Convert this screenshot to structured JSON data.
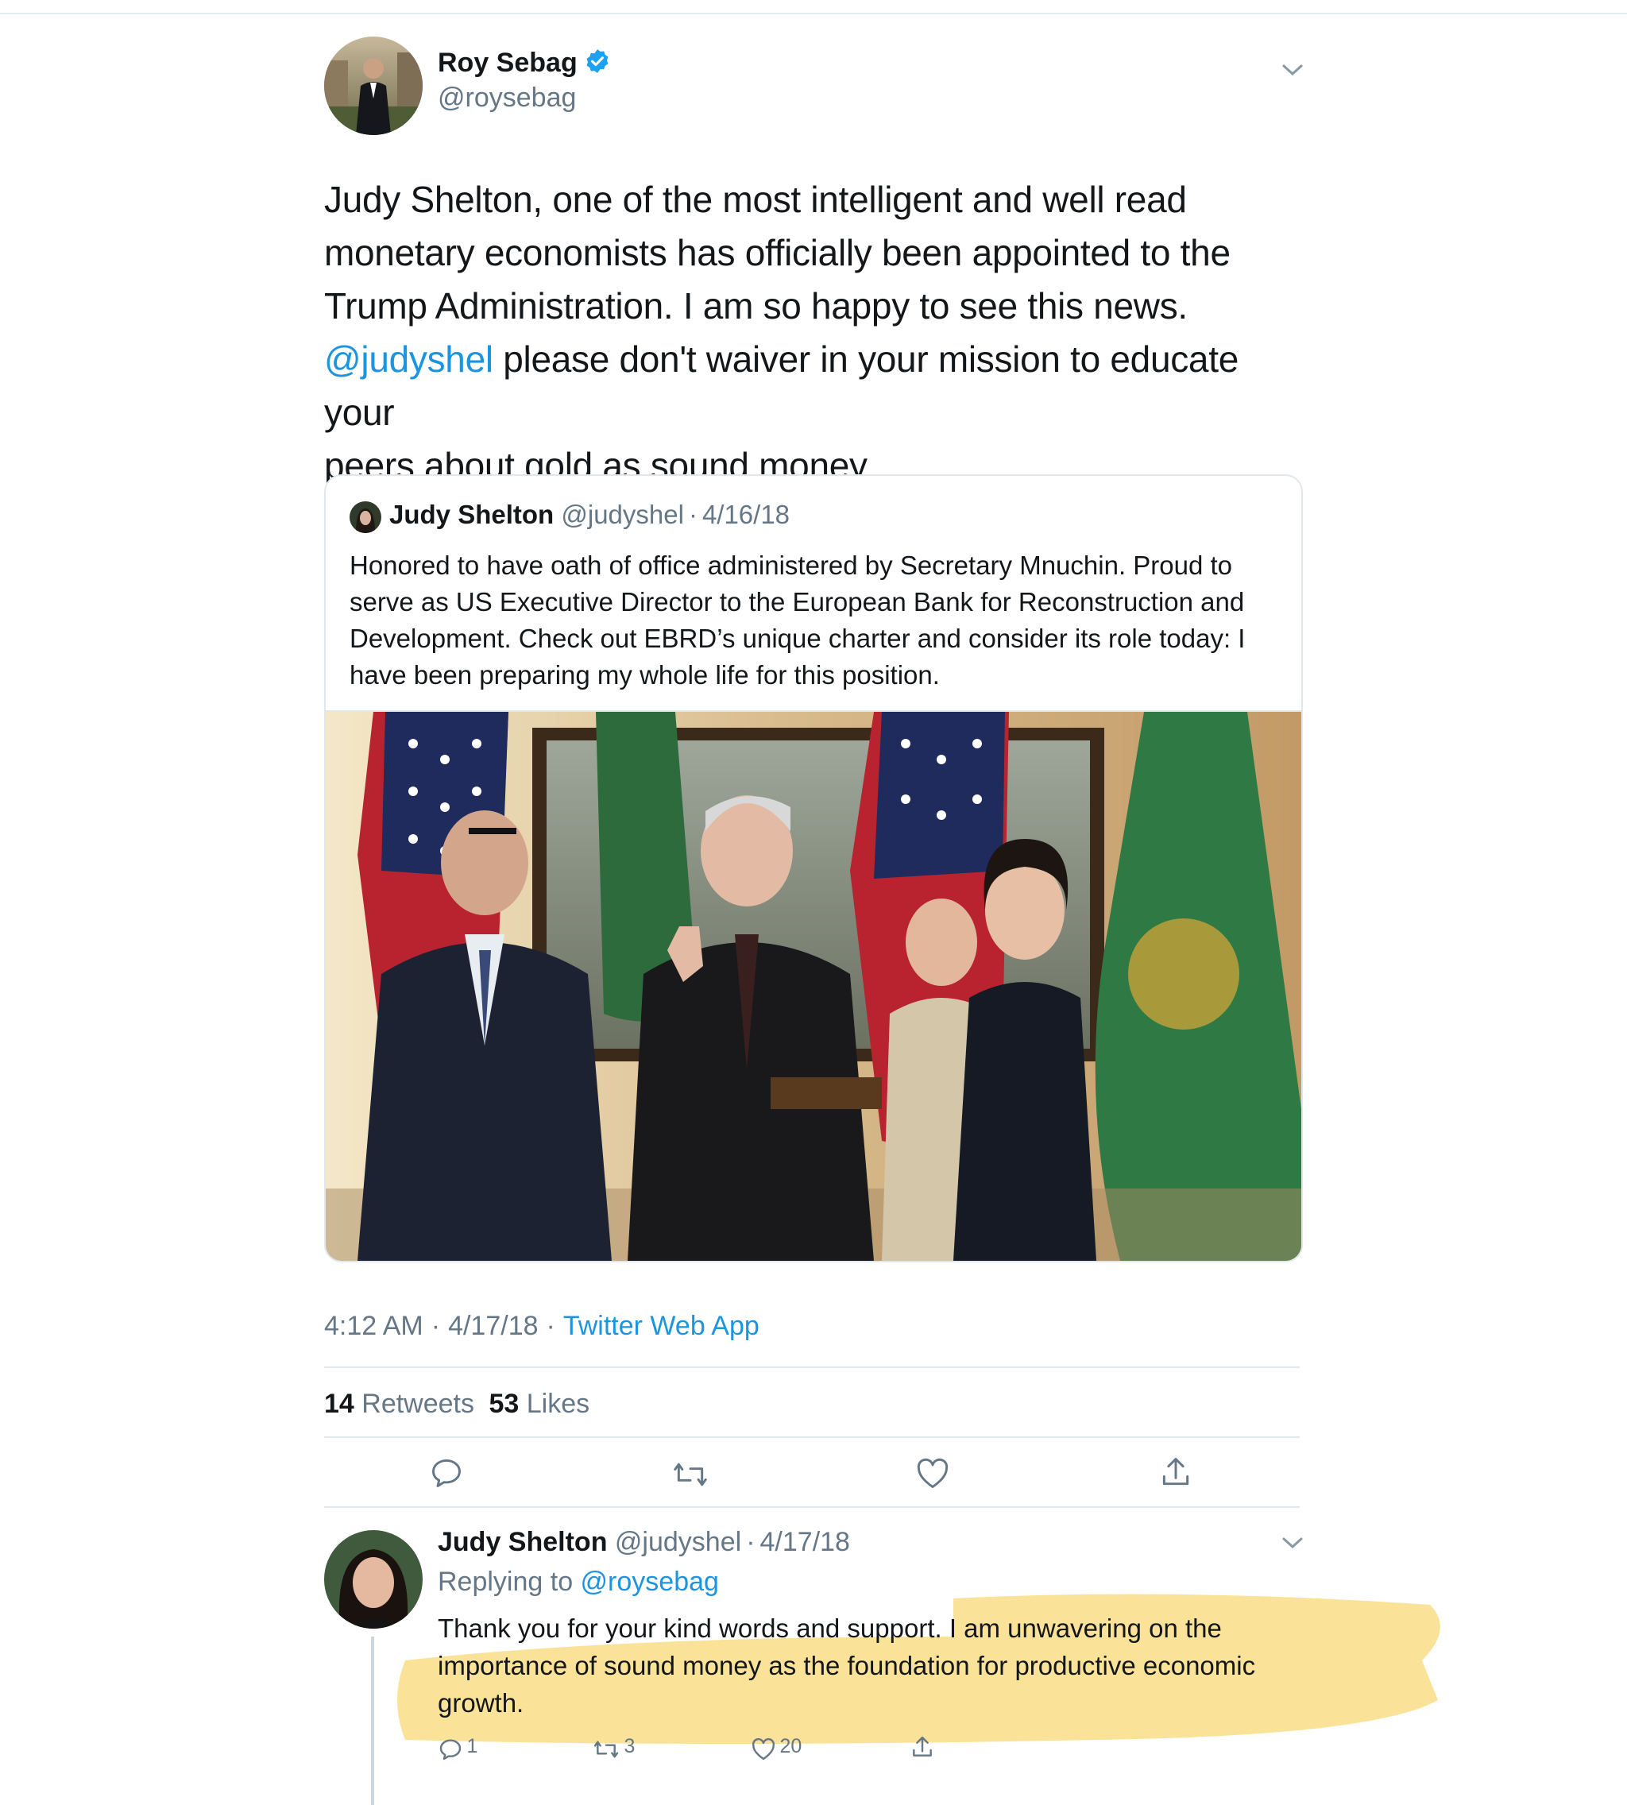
{
  "main_tweet": {
    "author_name": "Roy Sebag",
    "author_handle": "@roysebag",
    "text_lines": [
      "Judy Shelton, one of the most intelligent and well read",
      "monetary economists has officially been appointed to the",
      "Trump Administration. I am so happy to see this news."
    ],
    "mention": "@judyshel",
    "text_after_mention": " please don't waiver in your mission to educate your",
    "text_last_line": "peers about gold as sound money.",
    "time": "4:12 AM",
    "date": "4/17/18",
    "source": "Twitter Web App",
    "retweets_count": "14",
    "retweets_label": " Retweets",
    "likes_count": "53",
    "likes_label": " Likes"
  },
  "quoted_tweet": {
    "author_name": "Judy Shelton",
    "author_handle": "@judyshel",
    "date": "4/16/18",
    "separator": "·",
    "text_lines": [
      "Honored to have oath of office administered by Secretary Mnuchin. Proud to",
      "serve as US Executive Director to the European Bank for Reconstruction and",
      "Development. Check out EBRD’s unique charter and consider its role today: I",
      "have been preparing my whole life for this position."
    ]
  },
  "reply": {
    "author_name": "Judy Shelton",
    "author_handle": "@judyshel",
    "separator": "·",
    "date": "4/17/18",
    "replying_label": "Replying to ",
    "replying_to": "@roysebag",
    "text_lines": [
      "Thank you for your kind words and support. I am unwavering on the",
      "importance of sound money as the foundation for productive economic",
      "growth."
    ],
    "reply_count": "1",
    "retweet_count": "3",
    "like_count": "20"
  },
  "meta_separator": "·",
  "icons": [
    "verified-badge-icon",
    "chevron-down-icon",
    "reply-icon",
    "retweet-icon",
    "like-icon",
    "share-icon"
  ],
  "colors": {
    "link": "#1b95e0",
    "muted": "#657786",
    "text": "#14171a",
    "highlight": "#f6cc45",
    "verified": "#1da1f2"
  }
}
